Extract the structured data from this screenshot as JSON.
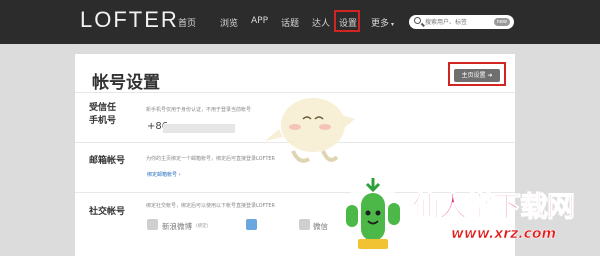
{
  "header": {
    "logo": "LOFTER",
    "nav": [
      {
        "label": "首页"
      },
      {
        "label": "浏览"
      },
      {
        "label": "APP"
      },
      {
        "label": "话题"
      },
      {
        "label": "达人"
      },
      {
        "label": "设置",
        "highlighted": true
      },
      {
        "label": "更多"
      }
    ],
    "search": {
      "placeholder": "搜索用户、标签",
      "badge": "new"
    }
  },
  "page": {
    "title": "帐号设置",
    "home_button": "主页设置",
    "sections": {
      "phone": {
        "label_line1": "受信任",
        "label_line2": "手机号",
        "description": "新手机号仅用于身份认证，不用于登录当前帐号",
        "prefix": "+86"
      },
      "email": {
        "label": "邮箱帐号",
        "description": "为你的主页绑定一个邮箱帐号，绑定后可直接登录LOFTER",
        "link": "绑定邮箱帐号"
      },
      "social": {
        "label": "社交帐号",
        "description": "绑定社交帐号，绑定后可以使用以下帐号直接登录LOFTER",
        "accounts": [
          {
            "name": "新浪微博",
            "tag": "(绑定)"
          },
          {
            "name": "微信"
          }
        ]
      }
    }
  },
  "watermark": {
    "brand": "仙人掌下载网",
    "url": "www.xrz.com"
  },
  "colors": {
    "header_bg": "#2c2c2c",
    "highlight_box": "#d32424",
    "link": "#2a6ebf",
    "watermark_pink": "#e0227f"
  }
}
